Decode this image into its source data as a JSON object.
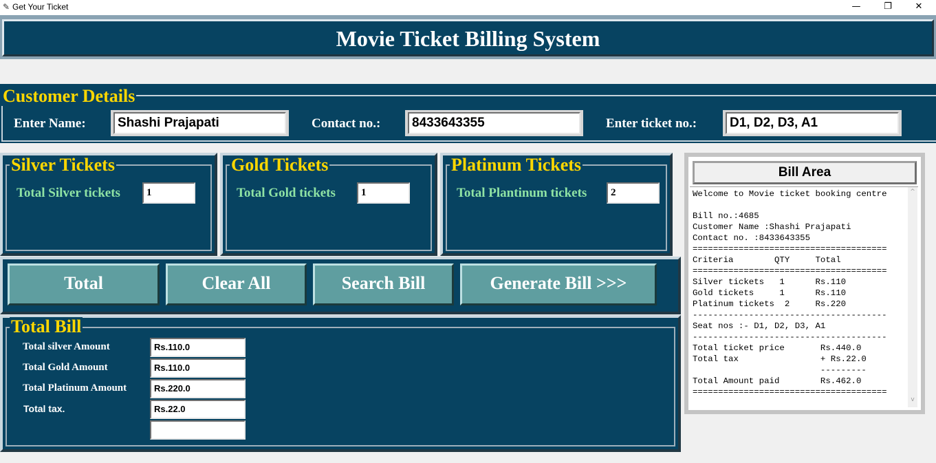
{
  "window": {
    "title": "Get Your Ticket",
    "icon": "feather-icon",
    "minimize": "—",
    "maximize": "❐",
    "close": "✕"
  },
  "header": {
    "title": "Movie Ticket Billing System"
  },
  "customer": {
    "legend": "Customer Details",
    "name_label": "Enter Name:",
    "name_value": "Shashi Prajapati",
    "contact_label": "Contact no.:",
    "contact_value": "8433643355",
    "ticket_label": "Enter ticket no.:",
    "ticket_value": "D1, D2, D3, A1"
  },
  "silver": {
    "legend": "Silver Tickets",
    "label": "Total Silver tickets",
    "value": "1"
  },
  "gold": {
    "legend": "Gold Tickets",
    "label": "Total Gold tickets",
    "value": "1"
  },
  "platinum": {
    "legend": "Platinum Tickets",
    "label": "Total Plantinum tickets",
    "value": "2"
  },
  "buttons": {
    "total": "Total",
    "clear_all": "Clear All",
    "search_bill": "Search Bill",
    "generate_bill": "Generate Bill >>>"
  },
  "total_bill": {
    "legend": "Total Bill",
    "rows": [
      {
        "label": "Total silver Amount",
        "value": "Rs.110.0"
      },
      {
        "label": "Total Gold Amount",
        "value": "Rs.110.0"
      },
      {
        "label": "Total Platinum Amount",
        "value": "Rs.220.0"
      },
      {
        "label": "Total tax.",
        "value": "Rs.22.0"
      },
      {
        "label": "",
        "value": ""
      }
    ]
  },
  "bill_area": {
    "heading": "Bill Area",
    "text": "Welcome to Movie ticket booking centre\n\nBill no.:4685\nCustomer Name :Shashi Prajapati\nContact no. :8433643355\n======================================\nCriteria        QTY     Total\n======================================\nSilver tickets   1      Rs.110\nGold tickets     1      Rs.110\nPlatinum tickets  2     Rs.220\n--------------------------------------\nSeat nos :- D1, D2, D3, A1\n--------------------------------------\nTotal ticket price       Rs.440.0\nTotal tax                + Rs.22.0\n                         ---------\nTotal Amount paid        Rs.462.0\n======================================",
    "scroll_up": "^",
    "scroll_down": "v"
  },
  "colors": {
    "panel": "#074361",
    "legend": "#ffd700",
    "green_label": "#8fe3a4",
    "button": "#5f9ea0"
  }
}
